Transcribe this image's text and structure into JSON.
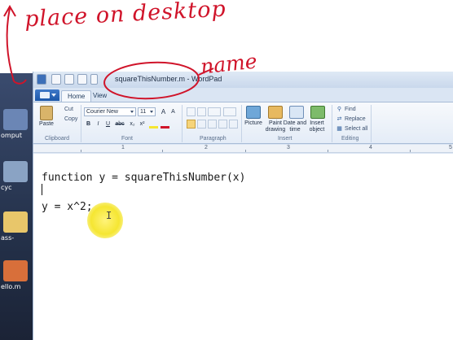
{
  "annotations": {
    "place_note": "place on desktop",
    "name_note": "name"
  },
  "desktop": {
    "labels": [
      "omput",
      "cyc",
      "ass-",
      "ello.m"
    ]
  },
  "window": {
    "title": "squareThisNumber.m - WordPad"
  },
  "tabs": [
    "Home",
    "View"
  ],
  "ribbon": {
    "clipboard": {
      "paste": "Paste",
      "cut": "Cut",
      "copy": "Copy",
      "label": "Clipboard"
    },
    "font": {
      "family": "Courier New",
      "size": "11",
      "grow": "A",
      "shrink": "A",
      "bold": "B",
      "italic": "I",
      "underline": "U",
      "strike": "abc",
      "sub": "x₂",
      "sup": "x²",
      "label": "Font"
    },
    "paragraph": {
      "label": "Paragraph"
    },
    "insert": {
      "picture": "Picture",
      "paint": "Paint drawing",
      "datetime": "Date and time",
      "object": "Insert object",
      "label": "Insert"
    },
    "editing": {
      "find": "Find",
      "replace": "Replace",
      "select_all": "Select all",
      "label": "Editing"
    }
  },
  "ruler": {
    "numbers": [
      "1",
      "2",
      "3",
      "4",
      "5"
    ]
  },
  "document": {
    "lines": [
      "function y = squareThisNumber(x)",
      "y = x^2;"
    ]
  },
  "colors": {
    "annotation": "#d0142a",
    "cursor_highlight": "#f5e632",
    "ribbon_accent": "#1c57a9"
  }
}
